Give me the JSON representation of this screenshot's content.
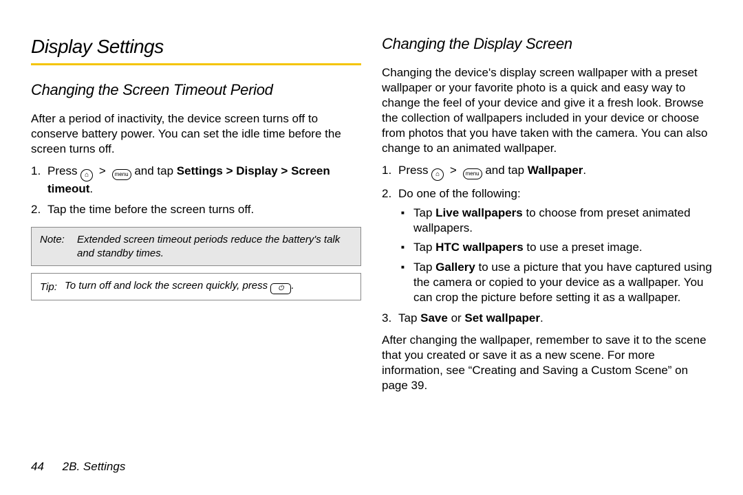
{
  "left": {
    "title": "Display Settings",
    "subhead": "Changing the Screen Timeout Period",
    "intro": "After a period of inactivity, the device screen turns off to conserve battery power. You can set the idle time before the screen turns off.",
    "step1_pre": "Press ",
    "step1_mid": " and tap ",
    "step1_bold": "Settings > Display > Screen timeout",
    "step1_post": ".",
    "step2": "Tap the time before the screen turns off.",
    "note_label": "Note:",
    "note_body": "Extended screen timeout periods reduce the battery's talk and standby times.",
    "tip_label": "Tip:",
    "tip_body_pre": "To turn off and lock the screen quickly, press ",
    "tip_body_post": "."
  },
  "right": {
    "subhead": "Changing the Display Screen",
    "intro": "Changing the device's display screen wallpaper with a preset wallpaper or your favorite photo is a quick and easy way to change the feel of your device and give it a fresh look. Browse the collection of wallpapers included in your device or choose from photos that you have taken with the camera. You can also change to an animated wallpaper.",
    "step1_pre": "Press ",
    "step1_mid": " and tap ",
    "step1_bold": "Wallpaper",
    "step1_post": ".",
    "step2": "Do one of the following:",
    "b1_pre": "Tap ",
    "b1_bold": "Live wallpapers",
    "b1_post": " to choose from preset animated wallpapers.",
    "b2_pre": "Tap ",
    "b2_bold": "HTC wallpapers",
    "b2_post": " to use a preset image.",
    "b3_pre": "Tap ",
    "b3_bold": "Gallery",
    "b3_post": " to use a picture that you have captured using the camera or copied to your device as a wallpaper. You can crop the picture before setting it as a wallpaper.",
    "step3_pre": "Tap ",
    "step3_bold1": "Save",
    "step3_mid": " or ",
    "step3_bold2": "Set wallpaper",
    "step3_post": ".",
    "closing": "After changing the wallpaper, remember to save it to the scene that you created or save it as a new scene. For more information, see “Creating and Saving a Custom Scene” on page 39."
  },
  "icons": {
    "menu_label": "menu",
    "home_glyph": "⌂",
    "power_glyph": "⏻"
  },
  "footer": {
    "page": "44",
    "section": "2B. Settings"
  }
}
